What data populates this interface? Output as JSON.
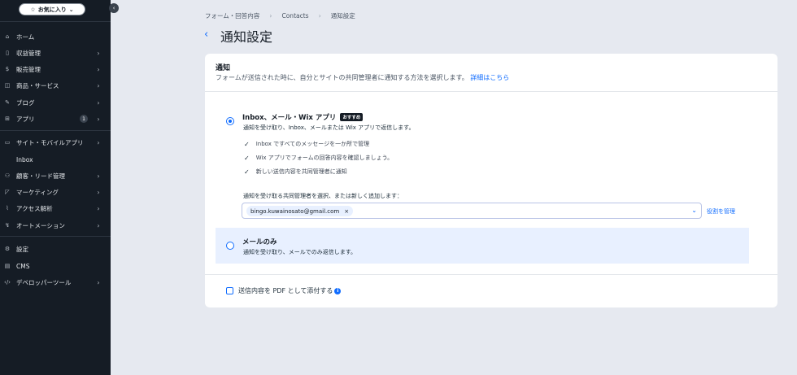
{
  "sidebar": {
    "favorites_label": "お気に入り",
    "items": [
      {
        "label": "ホーム",
        "icon": "home-icon",
        "has_chevron": false
      },
      {
        "label": "収益管理",
        "icon": "revenue-icon",
        "has_chevron": true
      },
      {
        "label": "販売管理",
        "icon": "sales-icon",
        "has_chevron": true
      },
      {
        "label": "商品・サービス",
        "icon": "products-icon",
        "has_chevron": true
      },
      {
        "label": "ブログ",
        "icon": "blog-icon",
        "has_chevron": true
      },
      {
        "label": "アプリ",
        "icon": "apps-icon",
        "has_chevron": true,
        "badge": "1"
      },
      {
        "label": "サイト・モバイルアプリ",
        "icon": "site-mobile-icon",
        "has_chevron": true
      },
      {
        "label": "Inbox",
        "icon": "inbox-icon",
        "has_chevron": false
      },
      {
        "label": "顧客・リード管理",
        "icon": "contacts-icon",
        "has_chevron": true
      },
      {
        "label": "マーケティング",
        "icon": "marketing-icon",
        "has_chevron": true
      },
      {
        "label": "アクセス解析",
        "icon": "analytics-icon",
        "has_chevron": true
      },
      {
        "label": "オートメーション",
        "icon": "automation-icon",
        "has_chevron": true
      },
      {
        "label": "設定",
        "icon": "settings-icon",
        "has_chevron": false
      },
      {
        "label": "CMS",
        "icon": "cms-icon",
        "has_chevron": false
      },
      {
        "label": "デベロッパーツール",
        "icon": "developer-icon",
        "has_chevron": true
      }
    ]
  },
  "breadcrumb": [
    "フォーム・回答内容",
    "Contacts",
    "通知設定"
  ],
  "page": {
    "title": "通知設定"
  },
  "card": {
    "title": "通知",
    "subtitle": "フォームが送信された時に、自分とサイトの共同管理者に通知する方法を選択します。",
    "learn_more": "詳細はこちら",
    "option1": {
      "title": "Inbox、メール・Wix アプリ",
      "badge": "おすすめ",
      "description": "通知を受け取り、Inbox、メールまたは Wix アプリで返信します。",
      "checked": true,
      "features": [
        "Inbox ですべてのメッセージを一か所で管理",
        "Wix アプリでフォームの回答内容を確認しましょう。",
        "新しい送信内容を共同管理者に通知"
      ],
      "recipients_label": "通知を受け取る共同管理者を選択、または新しく追加します：",
      "recipient_chip": "bingo.kuwainosato@gmail.com",
      "manage_roles": "役割を管理"
    },
    "option2": {
      "title": "メールのみ",
      "description": "通知を受け取り、メールでのみ返信します。",
      "checked": false
    },
    "pdf_label": "送信内容を PDF として添付する",
    "pdf_checked": false
  },
  "colors": {
    "accent": "#116dff",
    "sidebar_bg": "#151c25",
    "page_bg": "#e6e9f0",
    "selected_row_bg": "#e8f0ff"
  }
}
